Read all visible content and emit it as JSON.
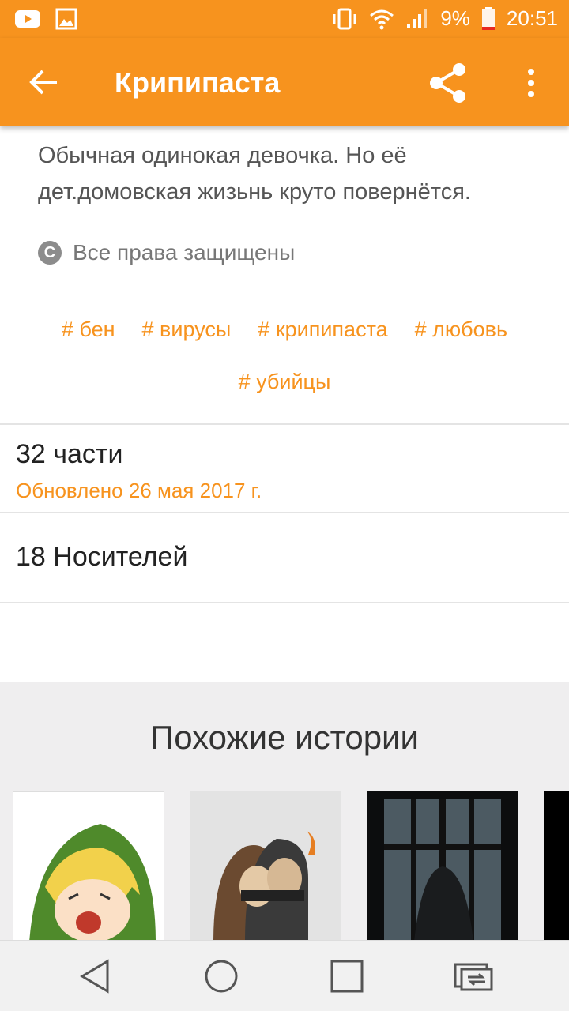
{
  "status_bar": {
    "battery": "9%",
    "time": "20:51"
  },
  "app_bar": {
    "title": "Крипипаста"
  },
  "story": {
    "description": "Обычная одинокая девочка. Но её дет.домовская жизьнь круто повернётся.",
    "rights": "Все права защищены",
    "tags_row1": [
      "# бен",
      "# вирусы",
      "# крипипаста",
      "# любовь"
    ],
    "tags_row2": [
      "# убийцы"
    ],
    "parts": "32 части",
    "updated": "Обновлено 26 мая 2017 г.",
    "carriers": "18 Носителей"
  },
  "similar": {
    "title": "Похожие истории"
  },
  "colors": {
    "accent": "#f7931e",
    "similar_bg": "#efeeef"
  }
}
